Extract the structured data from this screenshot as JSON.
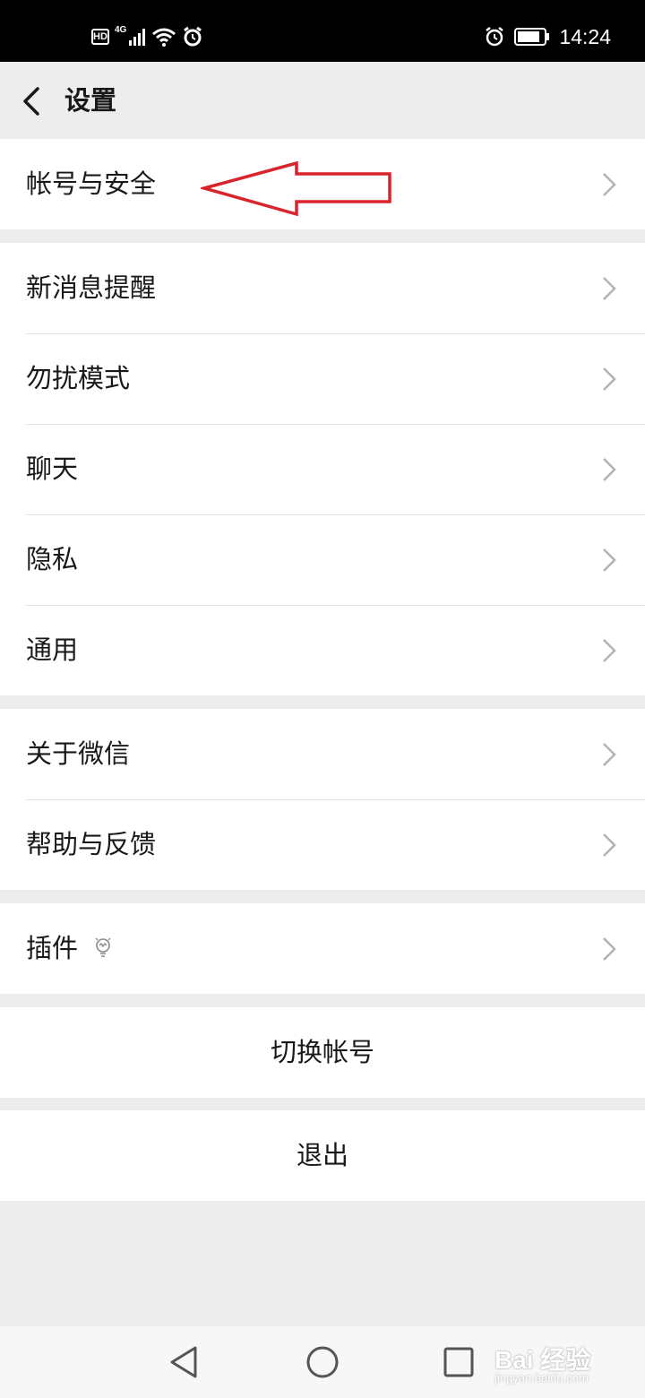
{
  "status_bar": {
    "hd_badge": "HD",
    "network_type": "4G",
    "time": "14:24",
    "icons": [
      "hd-icon",
      "signal-icon",
      "wifi-icon",
      "alarm-icon",
      "battery-icon"
    ]
  },
  "header": {
    "title": "设置",
    "back_icon": "chevron-left-icon"
  },
  "groups": [
    {
      "items": [
        {
          "label": "帐号与安全"
        }
      ]
    },
    {
      "items": [
        {
          "label": "新消息提醒"
        },
        {
          "label": "勿扰模式"
        },
        {
          "label": "聊天"
        },
        {
          "label": "隐私"
        },
        {
          "label": "通用"
        }
      ]
    },
    {
      "items": [
        {
          "label": "关于微信"
        },
        {
          "label": "帮助与反馈"
        }
      ]
    },
    {
      "items": [
        {
          "label": "插件",
          "icon": "lightbulb-icon"
        }
      ]
    }
  ],
  "actions": {
    "switch_account": "切换帐号",
    "logout": "退出"
  },
  "annotation": {
    "arrow_color": "#d9232d",
    "points_to": "帐号与安全"
  },
  "nav_bar": {
    "icons": [
      "back-triangle-icon",
      "home-circle-icon",
      "recents-square-icon"
    ]
  },
  "watermark": {
    "brand": "Bai 经验",
    "url": "jingyan.baidu.com"
  },
  "colors": {
    "background": "#ededed",
    "text": "#191919",
    "chevron": "#b2b2b2"
  }
}
